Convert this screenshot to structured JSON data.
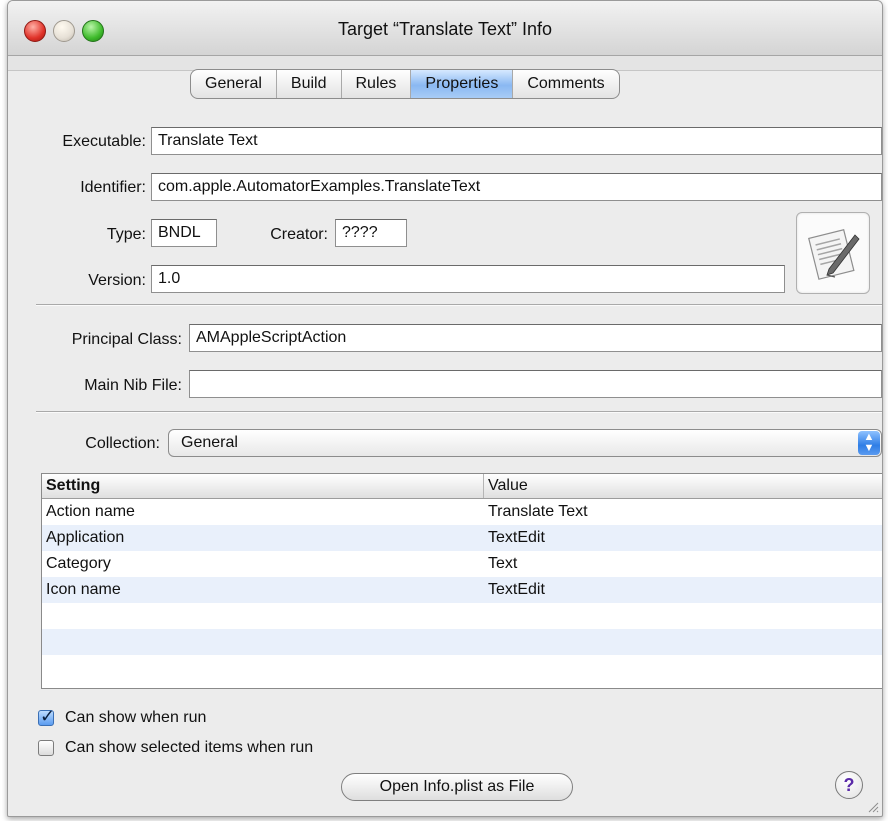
{
  "window": {
    "title": "Target “Translate Text” Info"
  },
  "tabs": [
    {
      "label": "General"
    },
    {
      "label": "Build"
    },
    {
      "label": "Rules"
    },
    {
      "label": "Properties",
      "active": true
    },
    {
      "label": "Comments"
    }
  ],
  "form": {
    "executable_label": "Executable:",
    "executable_value": "Translate Text",
    "identifier_label": "Identifier:",
    "identifier_value": "com.apple.AutomatorExamples.TranslateText",
    "type_label": "Type:",
    "type_value": "BNDL",
    "creator_label": "Creator:",
    "creator_value": "????",
    "version_label": "Version:",
    "version_value": "1.0",
    "principal_class_label": "Principal Class:",
    "principal_class_value": "AMAppleScriptAction",
    "main_nib_label": "Main Nib File:",
    "main_nib_value": ""
  },
  "collection": {
    "label": "Collection:",
    "selected": "General"
  },
  "table": {
    "columns": {
      "setting": "Setting",
      "value": "Value"
    },
    "rows": [
      {
        "setting": "Action name",
        "value": "Translate Text"
      },
      {
        "setting": "Application",
        "value": "TextEdit"
      },
      {
        "setting": "Category",
        "value": "Text"
      },
      {
        "setting": "Icon name",
        "value": "TextEdit"
      }
    ]
  },
  "options": {
    "show_when_run": {
      "label": "Can show when run",
      "checked": true
    },
    "show_selected_items": {
      "label": "Can show selected items when run",
      "checked": false
    }
  },
  "buttons": {
    "open_plist": "Open Info.plist as File",
    "help": "?"
  },
  "icons": {
    "target_icon": "textedit-document-icon",
    "help_icon": "help-icon"
  }
}
